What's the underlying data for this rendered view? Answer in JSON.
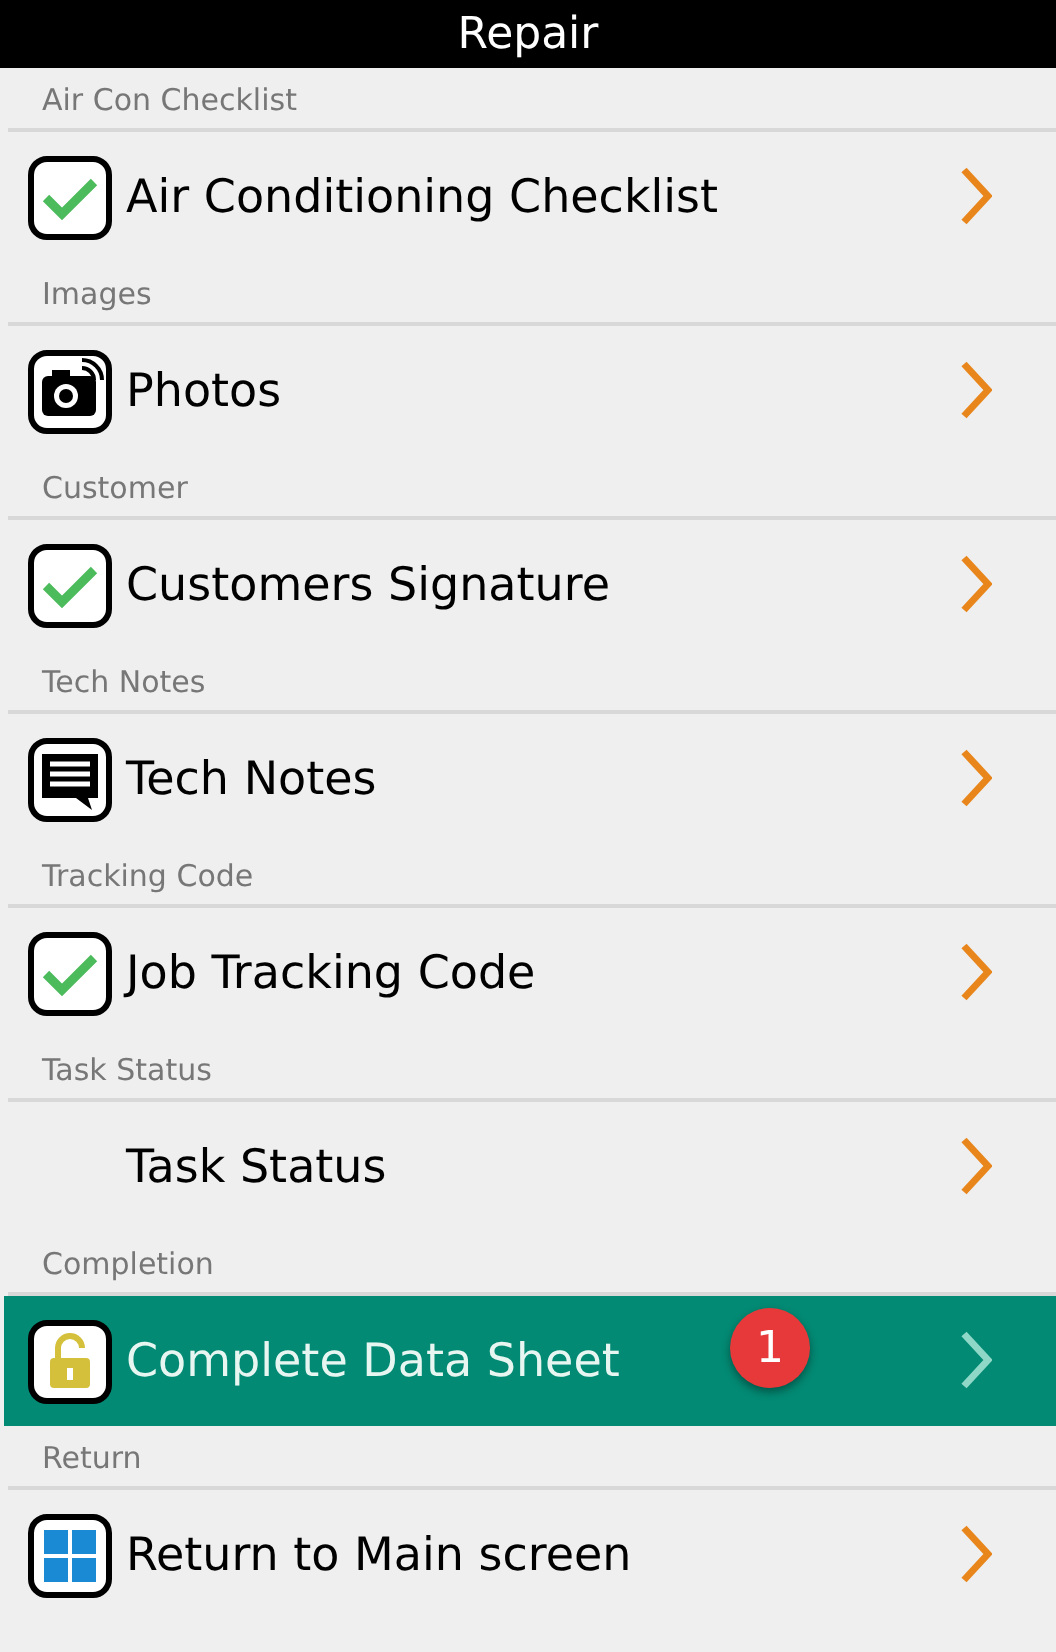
{
  "header": {
    "title": "Repair"
  },
  "sections": [
    {
      "label": "Air Con Checklist",
      "item": {
        "title": "Air Conditioning Checklist",
        "kind": "check",
        "selected": false
      }
    },
    {
      "label": "Images",
      "item": {
        "title": "Photos",
        "kind": "camera",
        "selected": false
      }
    },
    {
      "label": "Customer",
      "item": {
        "title": "Customers Signature",
        "kind": "check",
        "selected": false
      }
    },
    {
      "label": "Tech Notes",
      "item": {
        "title": "Tech Notes",
        "kind": "notes",
        "selected": false
      }
    },
    {
      "label": "Tracking Code",
      "item": {
        "title": "Job Tracking Code",
        "kind": "check",
        "selected": false
      }
    },
    {
      "label": "Task Status",
      "item": {
        "title": "Task Status",
        "kind": "plain",
        "selected": false
      }
    },
    {
      "label": "Completion",
      "item": {
        "title": "Complete Data Sheet",
        "kind": "lock",
        "selected": true,
        "badge": "1"
      }
    },
    {
      "label": "Return",
      "item": {
        "title": "Return to Main screen",
        "kind": "tiles",
        "selected": false
      }
    }
  ]
}
